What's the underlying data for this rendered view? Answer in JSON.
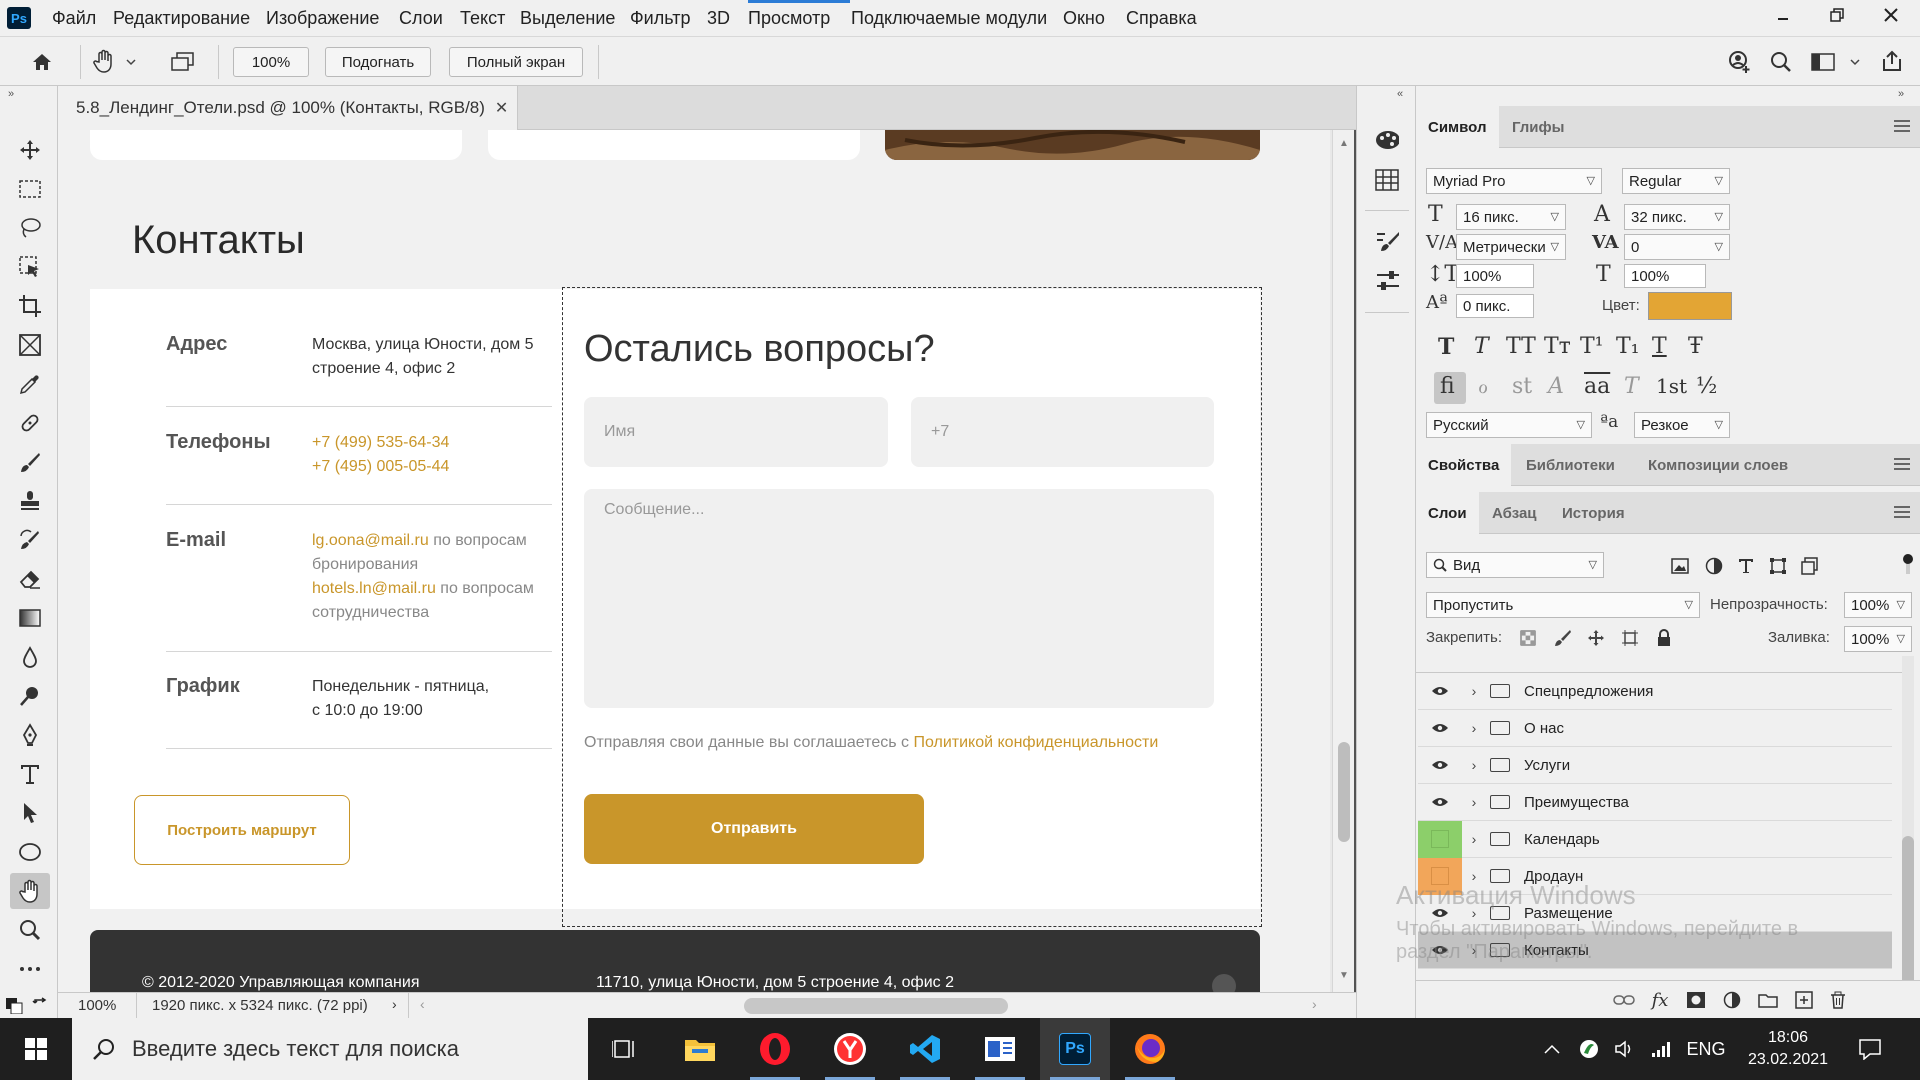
{
  "menubar": {
    "app_logo": "Ps",
    "items": [
      "Файл",
      "Редактирование",
      "Изображение",
      "Слои",
      "Текст",
      "Выделение",
      "Фильтр",
      "3D",
      "Просмотр",
      "Подключаемые модули",
      "Окно",
      "Справка"
    ]
  },
  "options": {
    "zoom": "100%",
    "fit": "Подогнать",
    "fullscreen": "Полный экран"
  },
  "document": {
    "tab_title": "5.8_Лендинг_Отели.psd @ 100% (Контакты, RGB/8)",
    "zoom_status": "100%",
    "size_status": "1920 пикс. x 5324 пикс. (72 ppi)"
  },
  "page": {
    "contacts_title": "Контакты",
    "address_label": "Адрес",
    "address_line1": "Москва, улица Юности, дом 5",
    "address_line2": "строение 4, офис 2",
    "phones_label": "Телефоны",
    "phone1": "+7 (499) 535-64-34",
    "phone2": "+7 (495) 005-05-44",
    "email_label": "E-mail",
    "email1": "lg.oona@mail.ru",
    "email1_note_a": " по вопросам",
    "email1_note_b": "бронирования",
    "email2": "hotels.ln@mail.ru",
    "email2_note_a": " по вопросам",
    "email2_note_b": "сотрудничества",
    "schedule_label": "График",
    "schedule_line1": "Понедельник - пятница,",
    "schedule_line2": "с 10:0 до 19:00",
    "route_button": "Построить маршрут",
    "form_title": "Остались вопросы?",
    "name_placeholder": "Имя",
    "phone_placeholder": "+7",
    "message_placeholder": "Сообщение...",
    "consent_text": "Отправляя свои данные вы соглашаетесь с ",
    "consent_link": "Политикой конфиденциальности",
    "send_button": "Отправить",
    "footer_copyright": "© 2012-2020 Управляющая компания",
    "footer_address": "11710, улица Юности, дом 5 строение 4, офис 2"
  },
  "character_panel": {
    "tabs": [
      "Символ",
      "Глифы"
    ],
    "font_family": "Myriad Pro",
    "font_style": "Regular",
    "font_size": "16 пикс.",
    "leading": "32 пикс.",
    "kerning": "Метрически",
    "tracking": "0",
    "vertical_scale": "100%",
    "horizontal_scale": "100%",
    "baseline_shift": "0 пикс.",
    "color_label": "Цвет:",
    "color_value": "#e3a534",
    "language": "Русский",
    "antialias": "Резкое",
    "aa_glyph": "ªa",
    "style_buttons": [
      "T",
      "T",
      "TT",
      "Tт",
      "T¹",
      "T₁",
      "T",
      "Ŧ"
    ],
    "opentype_buttons": [
      "fi",
      "ℴ",
      "st",
      "A",
      "aa",
      "T",
      "1st",
      "½"
    ]
  },
  "properties_panel": {
    "tabs": [
      "Свойства",
      "Библиотеки",
      "Композиции слоев"
    ]
  },
  "layers_panel": {
    "tabs": [
      "Слои",
      "Абзац",
      "История"
    ],
    "filter": "Вид",
    "blend_mode": "Пропустить",
    "opacity_label": "Непрозрачность:",
    "opacity": "100%",
    "lock_label": "Закрепить:",
    "fill_label": "Заливка:",
    "fill": "100%",
    "layers": [
      {
        "name": "Спецпредложения",
        "visible": true,
        "color": ""
      },
      {
        "name": "О нас",
        "visible": true,
        "color": ""
      },
      {
        "name": "Услуги",
        "visible": true,
        "color": ""
      },
      {
        "name": "Преимущества",
        "visible": true,
        "color": ""
      },
      {
        "name": "Календарь",
        "visible": false,
        "color": "#8ccf6a"
      },
      {
        "name": "Дродаун",
        "visible": false,
        "color": "#f2a65a"
      },
      {
        "name": "Размещение",
        "visible": true,
        "color": ""
      },
      {
        "name": "Контакты",
        "visible": true,
        "color": "",
        "selected": true
      }
    ]
  },
  "watermark": {
    "line1": "Активация Windows",
    "line2": "Чтобы активировать Windows, перейдите в",
    "line3": "раздел \"Параметры\"."
  },
  "taskbar": {
    "search_placeholder": "Введите здесь текст для поиска",
    "lang": "ENG",
    "time": "18:06",
    "date": "23.02.2021"
  },
  "colors": {
    "accent": "#c9962a",
    "ps_blue": "#31a8ff"
  }
}
